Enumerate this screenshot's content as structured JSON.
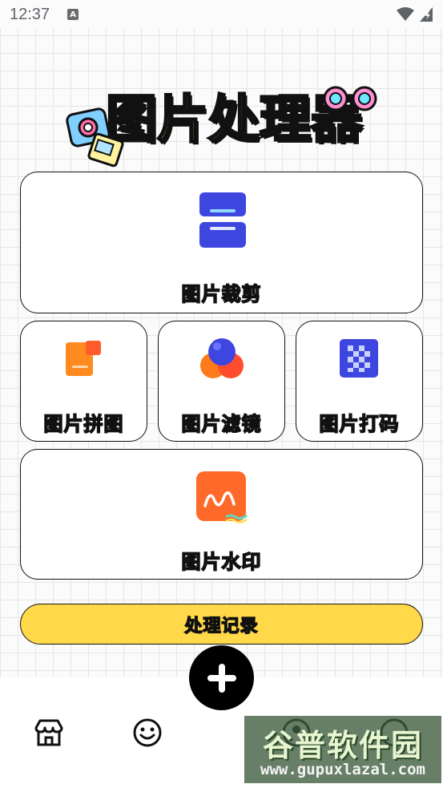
{
  "status_bar": {
    "time": "12:37",
    "notification_icon": "a-badge-icon",
    "wifi_icon": "wifi-icon",
    "battery_icon": "battery-charging-icon"
  },
  "app": {
    "title_chars": [
      "图",
      "片",
      "处",
      "理",
      "器"
    ],
    "title_colors": [
      "#ff6b6b",
      "#ffe14d",
      "#57c7ff",
      "#b57bff",
      "#8ee35a"
    ]
  },
  "tools": {
    "crop": {
      "label": "图片裁剪",
      "icon": "crop-icon",
      "color": "#3e46e0"
    },
    "collage": {
      "label": "图片拼图",
      "icon": "collage-icon",
      "color": "#ff8a1f"
    },
    "filter": {
      "label": "图片滤镜",
      "icon": "filter-icon",
      "color": "#ff7a1a"
    },
    "mosaic": {
      "label": "图片打码",
      "icon": "mosaic-icon",
      "color": "#3e46e0"
    },
    "watermark": {
      "label": "图片水印",
      "icon": "watermark-icon",
      "color": "#ff6a2a"
    }
  },
  "history_button": {
    "label": "处理记录",
    "color": "#ffd94a"
  },
  "bottom_nav": {
    "add_icon": "add-icon",
    "items": [
      {
        "icon": "store-icon"
      },
      {
        "icon": "smiley-icon"
      },
      {
        "icon": "profile-icon"
      },
      {
        "icon": "more-icon"
      }
    ]
  },
  "overlay_watermark": {
    "text": "谷普软件园",
    "url": "www.gupuxlazal.com"
  }
}
